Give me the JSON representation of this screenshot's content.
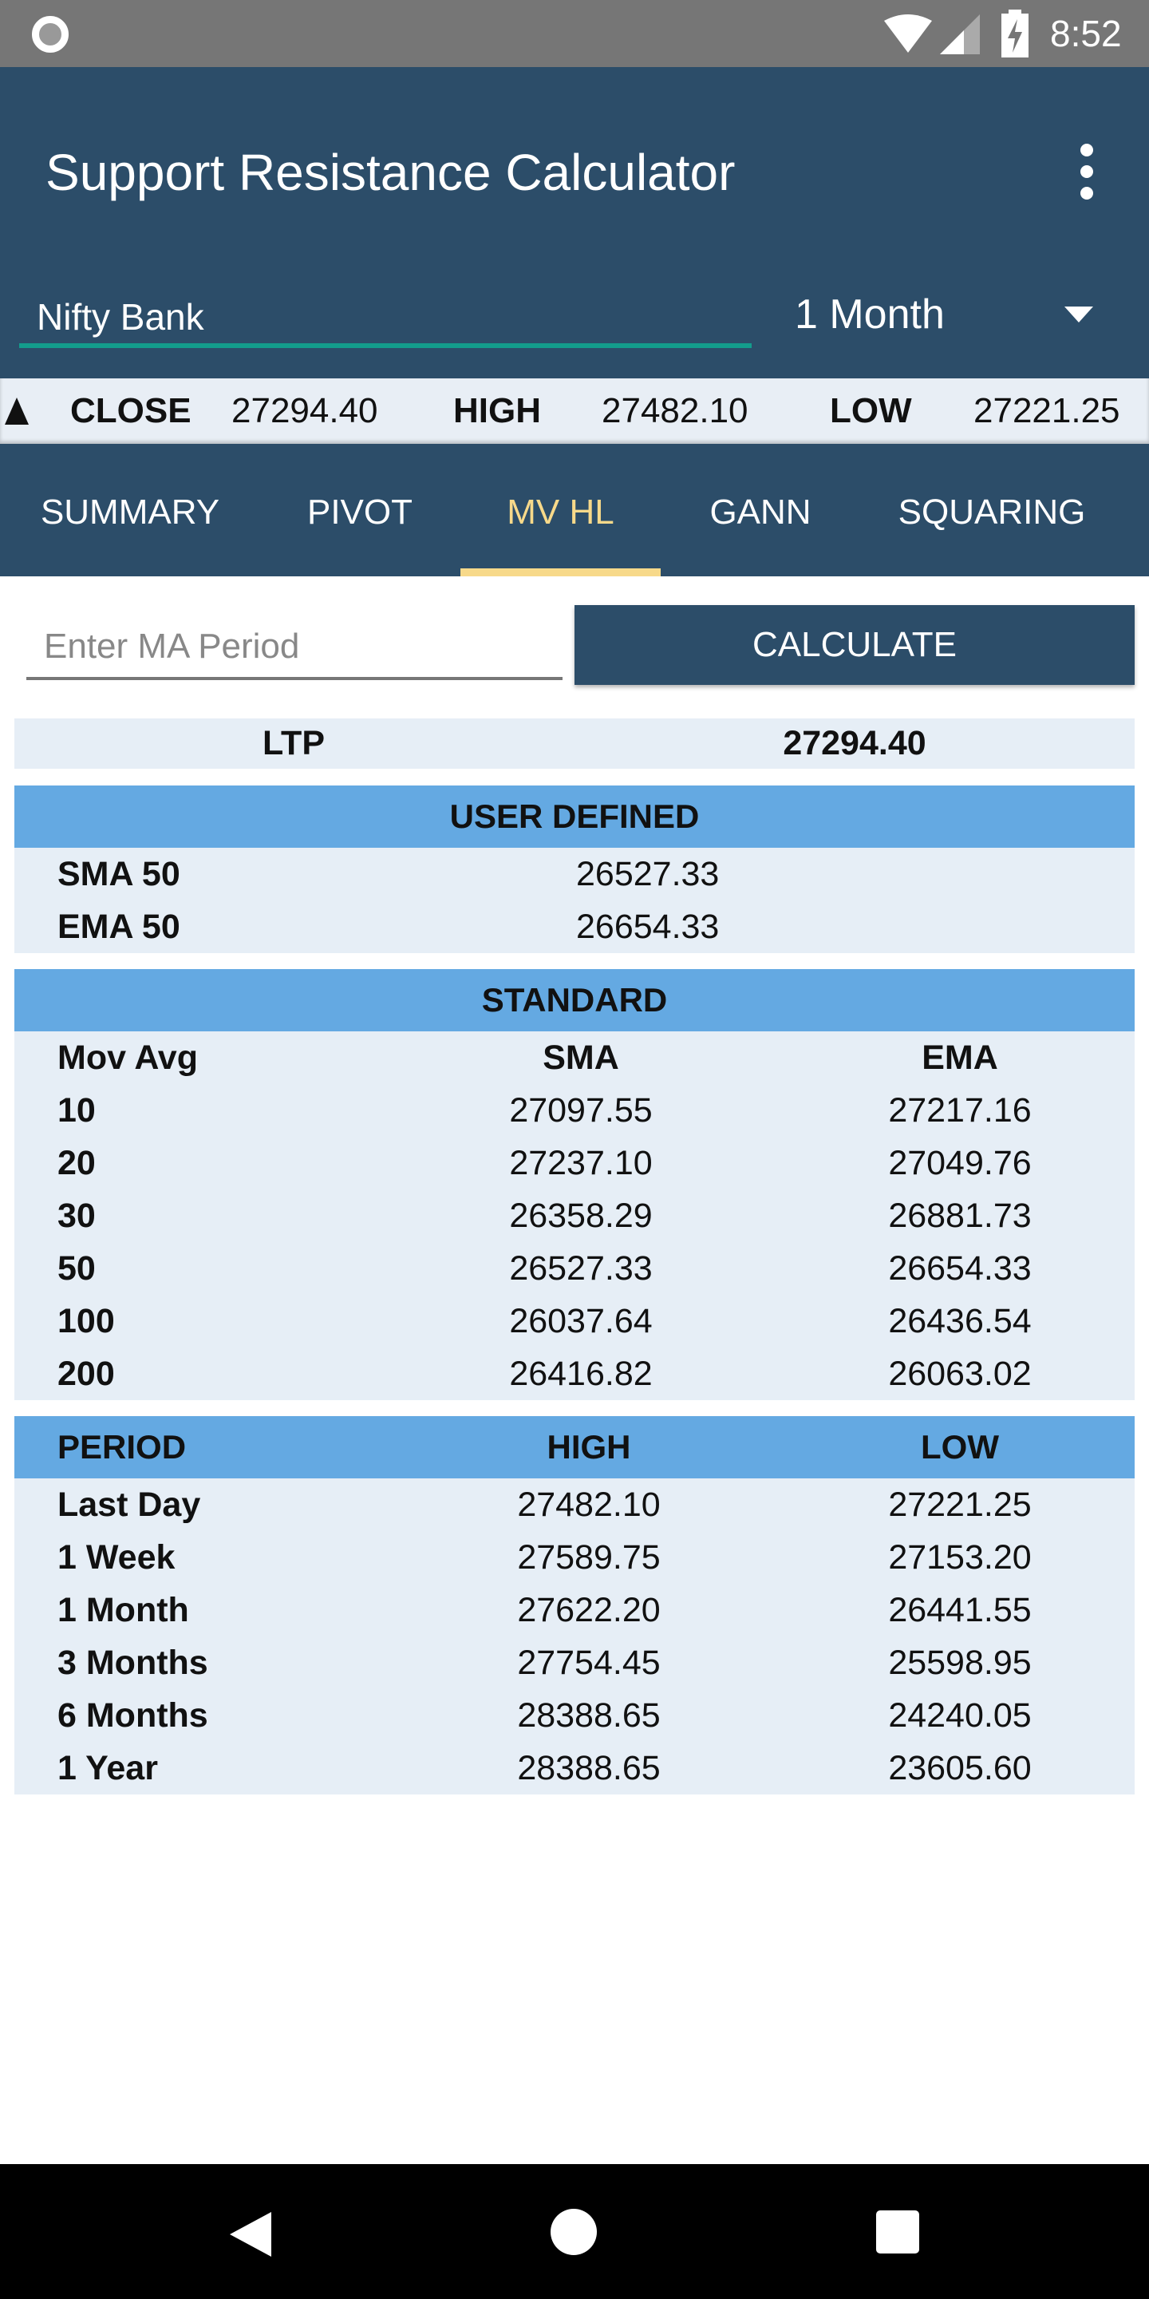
{
  "status_bar": {
    "time": "8:52"
  },
  "app_bar": {
    "title": "Support Resistance Calculator",
    "symbol": "Nifty Bank",
    "period": "1 Month"
  },
  "ticker": {
    "close_label": "CLOSE",
    "close": "27294.40",
    "high_label": "HIGH",
    "high": "27482.10",
    "low_label": "LOW",
    "low": "27221.25"
  },
  "tabs": [
    {
      "label": "SUMMARY"
    },
    {
      "label": "PIVOT"
    },
    {
      "label": "MV HL",
      "active": true
    },
    {
      "label": "GANN"
    },
    {
      "label": "SQUARING"
    }
  ],
  "input": {
    "placeholder": "Enter MA Period",
    "value": ""
  },
  "calculate_label": "CALCULATE",
  "ltp": {
    "label": "LTP",
    "value": "27294.40"
  },
  "user_defined": {
    "title": "USER DEFINED",
    "rows": [
      {
        "label": "SMA 50",
        "value": "26527.33"
      },
      {
        "label": "EMA 50",
        "value": "26654.33"
      }
    ]
  },
  "standard": {
    "title": "STANDARD",
    "headers": [
      "Mov Avg",
      "SMA",
      "EMA"
    ],
    "rows": [
      [
        "10",
        "27097.55",
        "27217.16"
      ],
      [
        "20",
        "27237.10",
        "27049.76"
      ],
      [
        "30",
        "26358.29",
        "26881.73"
      ],
      [
        "50",
        "26527.33",
        "26654.33"
      ],
      [
        "100",
        "26037.64",
        "26436.54"
      ],
      [
        "200",
        "26416.82",
        "26063.02"
      ]
    ]
  },
  "periods": {
    "headers": [
      "PERIOD",
      "HIGH",
      "LOW"
    ],
    "rows": [
      [
        "Last Day",
        "27482.10",
        "27221.25"
      ],
      [
        "1 Week",
        "27589.75",
        "27153.20"
      ],
      [
        "1 Month",
        "27622.20",
        "26441.55"
      ],
      [
        "3 Months",
        "27754.45",
        "25598.95"
      ],
      [
        "6 Months",
        "28388.65",
        "24240.05"
      ],
      [
        "1 Year",
        "28388.65",
        "23605.60"
      ]
    ]
  },
  "colors": {
    "primary": "#2c4d69",
    "accent": "#f7d98a",
    "section_header": "#64a9e2",
    "row_bg": "#e6eef6",
    "input_focus": "#139c8c"
  }
}
